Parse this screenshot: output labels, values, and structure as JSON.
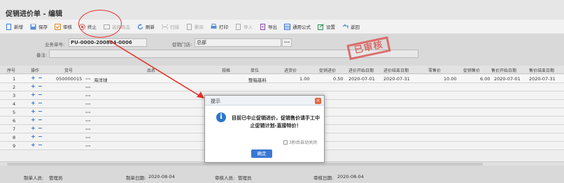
{
  "window": {
    "title": "促销进价单 - 编辑"
  },
  "toolbar": {
    "items": [
      {
        "label": "新增",
        "icon": "new-doc-icon",
        "enabled": true
      },
      {
        "label": "保存",
        "icon": "save-icon",
        "enabled": true
      },
      {
        "label": "审核",
        "icon": "audit-icon",
        "enabled": true
      },
      {
        "label": "终止",
        "icon": "stop-icon",
        "enabled": true
      },
      {
        "label": "选择商品",
        "icon": "select-goods-icon",
        "enabled": false
      },
      {
        "label": "刷新",
        "icon": "refresh-icon",
        "enabled": true
      },
      {
        "label": "扫描",
        "icon": "scan-icon",
        "enabled": false
      },
      {
        "label": "删除",
        "icon": "delete-icon",
        "enabled": false
      },
      {
        "label": "打印",
        "icon": "print-icon",
        "enabled": true
      },
      {
        "label": "导入",
        "icon": "import-icon",
        "enabled": false
      },
      {
        "label": "导出",
        "icon": "export-icon",
        "enabled": true
      },
      {
        "label": "通用公式",
        "icon": "formula-icon",
        "enabled": true
      },
      {
        "label": "设置",
        "icon": "settings-icon",
        "enabled": true
      },
      {
        "label": "返回",
        "icon": "back-icon",
        "enabled": true
      }
    ]
  },
  "form": {
    "order_no_label": "业务单号:",
    "order_no_value": "PU-0000-200804-0006",
    "store_label": "促销门店:",
    "store_value": "总部",
    "remark_label": "备注:",
    "remark_value": "",
    "stamp_text": "已审核"
  },
  "grid": {
    "columns": [
      "序号",
      "操作",
      "货号",
      "品名",
      "规格",
      "单位",
      "进货价",
      "促销进价",
      "进价开始日期",
      "进价结束日期",
      "零售价",
      "促销售价",
      "售价开始日期",
      "售价结束日期"
    ],
    "rows": [
      {
        "no": "1",
        "code": "050000015",
        "name": "海洋球",
        "spec": "",
        "unit": "整箱基料",
        "price": "1.00",
        "promo_price": "0.50",
        "start": "2020-07-01",
        "end": "2020-07-31",
        "retail": "10.00",
        "promo_retail": "6.00",
        "sale_start": "2020-07-01",
        "sale_end": "2020-07-31"
      },
      {
        "no": "2"
      },
      {
        "no": "3"
      },
      {
        "no": "4"
      },
      {
        "no": "5"
      },
      {
        "no": "6"
      },
      {
        "no": "7"
      },
      {
        "no": "8"
      },
      {
        "no": "9"
      }
    ]
  },
  "footer": {
    "creator_label": "制单人员:",
    "creator": "管理员",
    "create_date_label": "制单日期:",
    "create_date": "2020-08-04",
    "auditor_label": "审核人员:",
    "auditor": "管理员",
    "audit_date_label": "审核日期:",
    "audit_date": "2020-08-04"
  },
  "dialog": {
    "title": "提示",
    "message": "目前已中止促销进价，促销售价请手工中止促销计划-直接特价！",
    "auto_close": "3秒后自动关闭",
    "ok_label": "确定"
  },
  "colors": {
    "accent": "#3a78d4",
    "annotation_red": "#e4332a",
    "stamp_red": "#d9534f"
  }
}
